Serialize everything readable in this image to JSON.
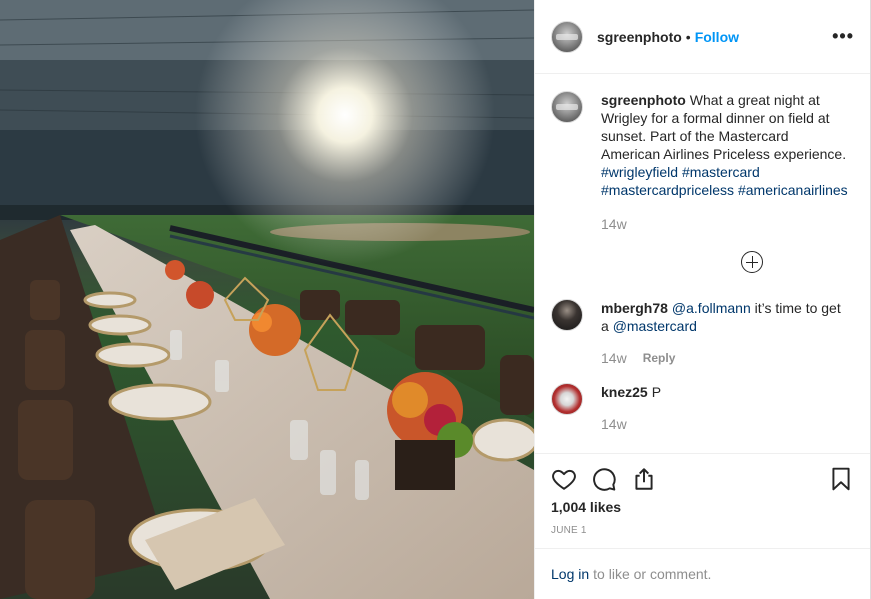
{
  "post": {
    "author": "sgreenphoto",
    "separator": "•",
    "follow_label": "Follow",
    "more_label": "•••"
  },
  "comments": [
    {
      "user": "sgreenphoto",
      "text": "What a great night at Wrigley for a formal dinner on field at sunset. Part of the Mastercard American Airlines Priceless experience.",
      "tags": [
        "#wrigleyfield",
        "#mastercard",
        "#mastercardpriceless",
        "#americanairlines"
      ],
      "time": "14w"
    },
    {
      "user": "mbergh78",
      "mention": "@a.follmann",
      "text": "it’s time to get a",
      "mention2": "@mastercard",
      "time": "14w",
      "reply_label": "Reply"
    },
    {
      "user": "knez25",
      "text": "P",
      "time": "14w"
    }
  ],
  "actions": {
    "like_icon": "heart-icon",
    "comment_icon": "comment-icon",
    "share_icon": "share-icon",
    "save_icon": "bookmark-icon"
  },
  "likes": "1,004 likes",
  "date": "JUNE 1",
  "login": {
    "link": "Log in",
    "text": "to like or comment."
  }
}
